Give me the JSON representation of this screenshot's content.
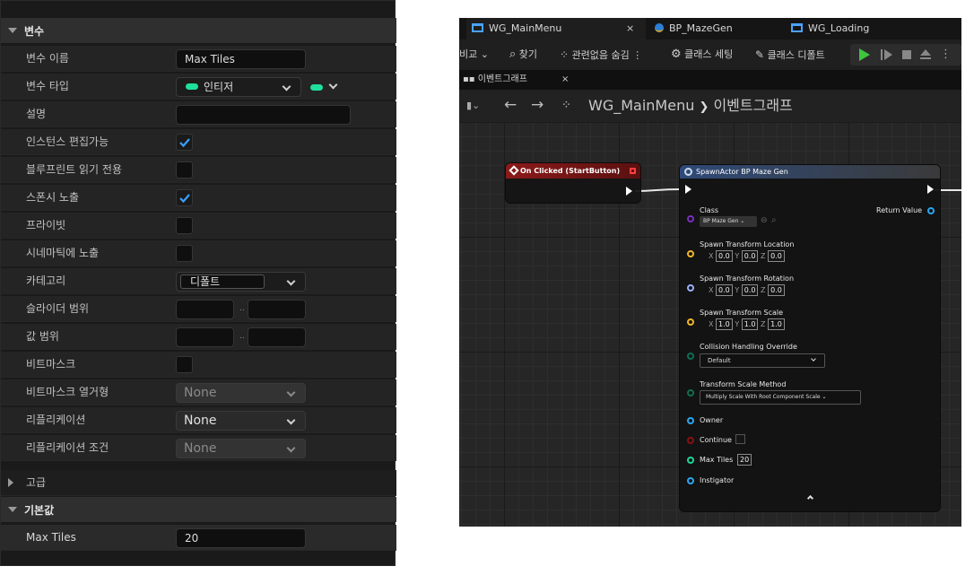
{
  "details": {
    "variables_section": "변수",
    "rows": [
      {
        "label": "변수 이름",
        "value": "Max Tiles"
      },
      {
        "label": "변수 타입",
        "value": "인티저"
      },
      {
        "label": "설명",
        "value": ""
      },
      {
        "label": "인스턴스 편집가능",
        "checked": true
      },
      {
        "label": "블루프린트 읽기 전용",
        "checked": false
      },
      {
        "label": "스폰시 노출",
        "checked": true
      },
      {
        "label": "프라이빗",
        "checked": false
      },
      {
        "label": "시네마틱에 노출",
        "checked": false
      },
      {
        "label": "카테고리",
        "value": "디폴트"
      },
      {
        "label": "슬라이더 범위",
        "separator": ".."
      },
      {
        "label": "값 범위",
        "separator": ".."
      },
      {
        "label": "비트마스크",
        "checked": false
      },
      {
        "label": "비트마스크 열거형",
        "value": "None"
      },
      {
        "label": "리플리케이션",
        "value": "None"
      },
      {
        "label": "리플리케이션 조건",
        "value": "None"
      }
    ],
    "advanced_section": "고급",
    "defaults_section": "기본값",
    "default_row": {
      "label": "Max Tiles",
      "value": "20"
    },
    "type_color": "#1fe09b"
  },
  "editor": {
    "tabs": [
      {
        "label": "WG_MainMenu",
        "close": "×"
      },
      {
        "label": "BP_MazeGen"
      },
      {
        "label": "WG_Loading"
      }
    ],
    "toolbar": {
      "diff": "비교",
      "find": "찾기",
      "hide_unrelated": "관련없음 숨김",
      "class_settings": "클래스 세팅",
      "class_defaults": "클래스 디폴트"
    },
    "graph_tab": {
      "label": "이벤트그래프",
      "close": "×"
    },
    "breadcrumb": {
      "root": "WG_MainMenu",
      "sep": "❯",
      "current": "이벤트그래프"
    },
    "event_node": {
      "title": "On Clicked (StartButton)"
    },
    "spawn_node": {
      "title": "SpawnActor BP Maze Gen",
      "class_label": "Class",
      "class_value": "BP Maze Gen",
      "return_value": "Return Value",
      "location_label": "Spawn Transform Location",
      "location": {
        "x": "0.0",
        "y": "0.0",
        "z": "0.0"
      },
      "rotation_label": "Spawn Transform Rotation",
      "rotation": {
        "x": "0.0",
        "y": "0.0",
        "z": "0.0"
      },
      "scale_label": "Spawn Transform Scale",
      "scale": {
        "x": "1.0",
        "y": "1.0",
        "z": "1.0"
      },
      "axis": {
        "x": "X",
        "y": "Y",
        "z": "Z"
      },
      "collision_label": "Collision Handling Override",
      "collision_value": "Default",
      "scale_method_label": "Transform Scale Method",
      "scale_method_value": "Multiply Scale With Root Component Scale",
      "owner": "Owner",
      "continue": "Continue",
      "max_tiles_label": "Max Tiles",
      "max_tiles_value": "20",
      "instigator": "Instigator"
    },
    "colors": {
      "event_header": "#8b1a1a",
      "spawn_header": "#2f4a78",
      "class_pin": "#7b2fbe",
      "vector_pin": "#f3b626",
      "rotator_pin": "#9bb0ff",
      "struct_pin": "#0f6e52",
      "object_pin": "#2aa7f0",
      "bool_pin": "#8b1010",
      "int_pin": "#20d49a",
      "play": "#3ec43e"
    }
  }
}
